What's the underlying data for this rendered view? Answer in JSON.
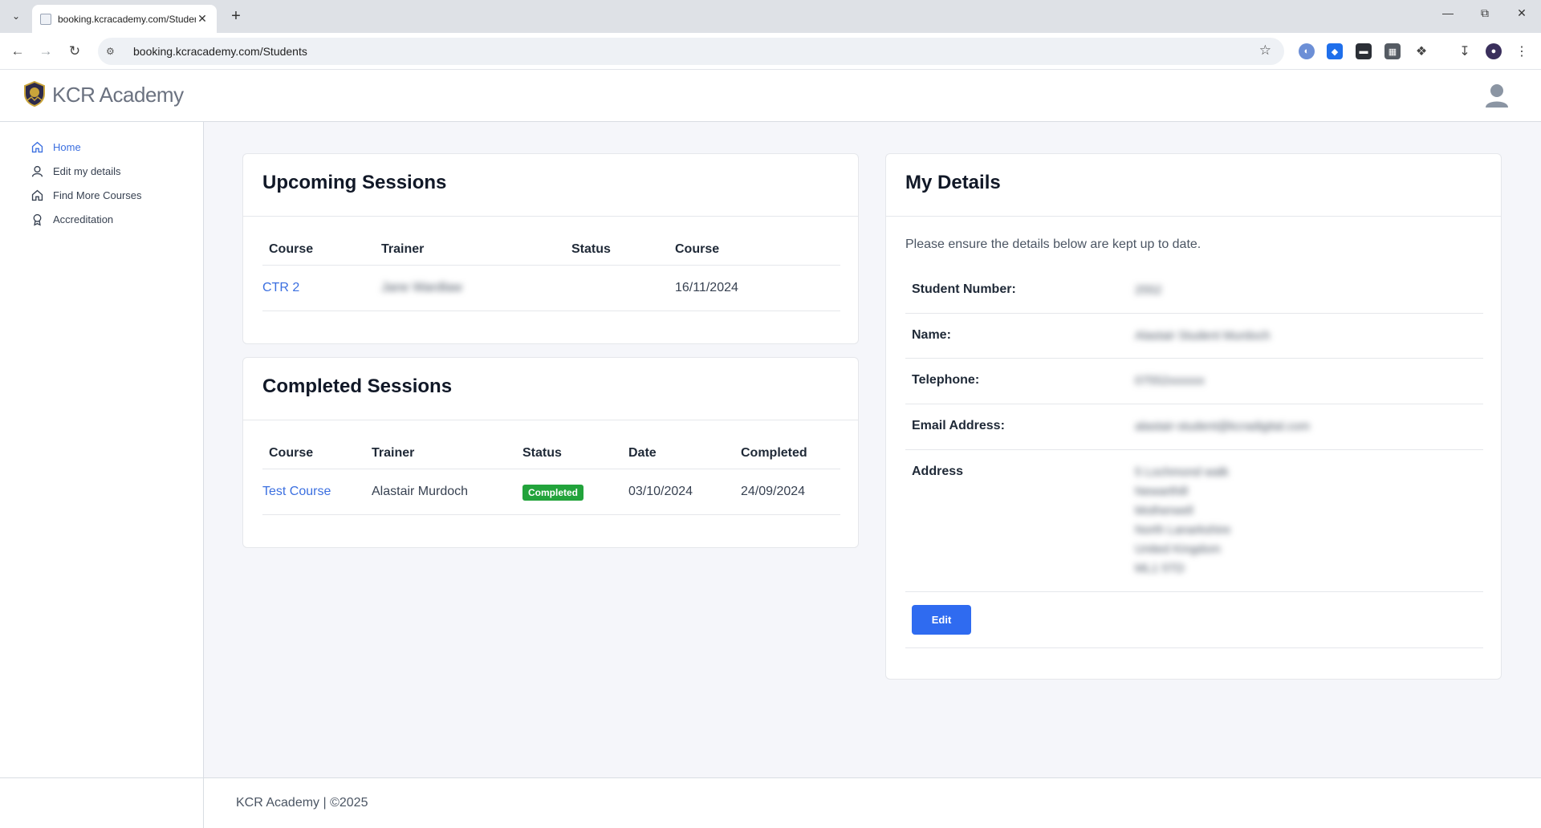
{
  "browser": {
    "tab_title": "booking.kcracademy.com/Students",
    "url": "booking.kcracademy.com/Students",
    "new_tab": "+",
    "close": "✕"
  },
  "app": {
    "brand": "KCR Academy"
  },
  "sidebar": {
    "items": [
      {
        "label": "Home",
        "icon": "home-icon",
        "active": true
      },
      {
        "label": "Edit my details",
        "icon": "user-icon",
        "active": false
      },
      {
        "label": "Find More Courses",
        "icon": "home-icon",
        "active": false
      },
      {
        "label": "Accreditation",
        "icon": "award-icon",
        "active": false
      }
    ]
  },
  "upcoming": {
    "title": "Upcoming Sessions",
    "headers": [
      "Course",
      "Trainer",
      "Status",
      "Course"
    ],
    "rows": [
      {
        "course": "CTR 2",
        "trainer": "Jane Wardlaw",
        "status": "",
        "date": "16/11/2024"
      }
    ]
  },
  "completed": {
    "title": "Completed Sessions",
    "headers": [
      "Course",
      "Trainer",
      "Status",
      "Date",
      "Completed"
    ],
    "rows": [
      {
        "course": "Test Course",
        "trainer": "Alastair Murdoch",
        "status": "Completed",
        "date": "03/10/2024",
        "completed": "24/09/2024"
      }
    ]
  },
  "details": {
    "title": "My Details",
    "intro": "Please ensure the details below are kept up to date.",
    "fields": [
      {
        "label": "Student Number:",
        "value": "2552"
      },
      {
        "label": "Name:",
        "value": "Alastair Student Murdoch"
      },
      {
        "label": "Telephone:",
        "value": "07552xxxxxx"
      },
      {
        "label": "Email Address:",
        "value": "alastair-student@kcradigital.com"
      }
    ],
    "address_label": "Address",
    "address_lines": [
      "5 Lochmond walk",
      "Newarthill",
      "Motherwell",
      "North Lanarkshire",
      "United Kingdom",
      "ML1 5TD"
    ],
    "edit_label": "Edit"
  },
  "footer": {
    "text": "KCR Academy | ©2025"
  },
  "colors": {
    "accent": "#3b6fe0",
    "button": "#2f6bf0",
    "badge": "#22a33b"
  }
}
